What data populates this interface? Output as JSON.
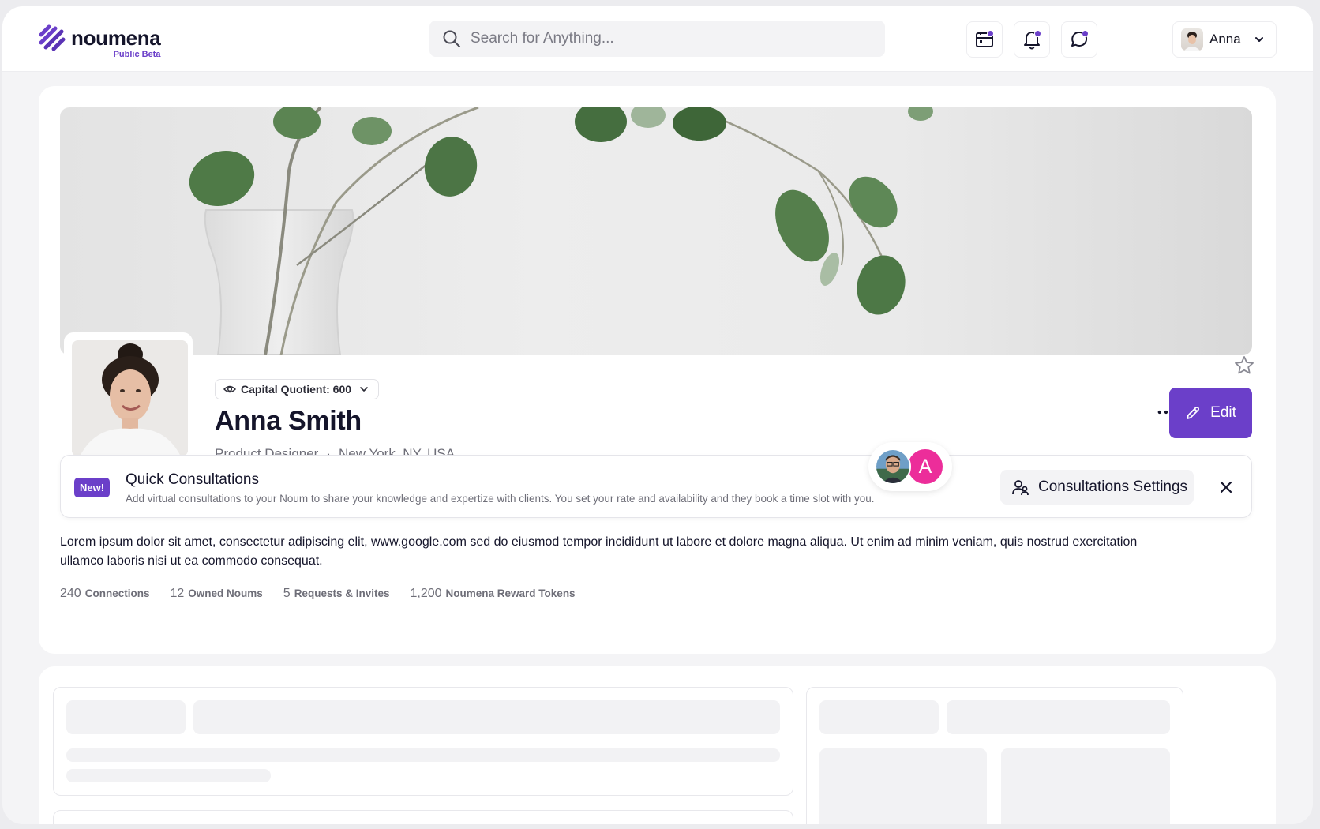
{
  "header": {
    "logo_name": "noumena",
    "logo_tag": "Public Beta",
    "search_placeholder": "Search for Anything...",
    "icons": [
      "calendar-icon",
      "bell-icon",
      "chat-icon"
    ],
    "user_name": "Anna"
  },
  "profile": {
    "capital_quotient": "Capital Quotient: 600",
    "name": "Anna Smith",
    "title": "Product Designer",
    "separator": "·",
    "location": "New York, NY, USA",
    "edit_label": "Edit"
  },
  "consultations": {
    "badge": "New!",
    "title": "Quick Consultations",
    "description": "Add virtual consultations to your Noum to share your knowledge and expertize with clients. You set your rate and availability and they book a time slot with you.",
    "avatar_letter": "A",
    "settings_label": "Consultations Settings"
  },
  "bio": "Lorem ipsum dolor sit amet, consectetur adipiscing elit, www.google.com sed do eiusmod tempor incididunt ut labore et dolore magna aliqua. Ut enim ad minim veniam, quis nostrud exercitation ullamco laboris nisi ut ea commodo consequat.",
  "stats": [
    {
      "value": "240",
      "label": "Connections"
    },
    {
      "value": "12",
      "label": "Owned Noums"
    },
    {
      "value": "5",
      "label": "Requests & Invites"
    },
    {
      "value": "1,200",
      "label": "Noumena Reward Tokens"
    }
  ],
  "colors": {
    "accent": "#6b3fc9",
    "pink": "#ec2d9a",
    "text": "#15152b",
    "muted": "#6e6e78"
  }
}
